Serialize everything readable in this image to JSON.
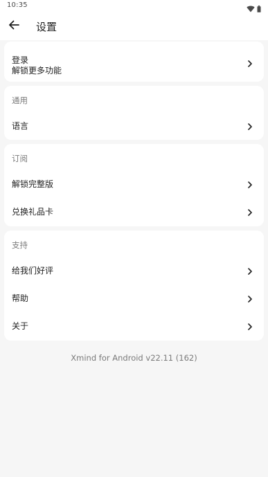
{
  "status_bar": {
    "time": "10:35",
    "icons": [
      "wifi-icon",
      "battery-icon"
    ]
  },
  "app_bar": {
    "back_icon": "arrow-left-icon",
    "title": "设置"
  },
  "account": {
    "title": "登录",
    "subtitle": "解锁更多功能"
  },
  "general": {
    "header": "通用",
    "items": [
      {
        "label": "语言"
      }
    ]
  },
  "subscription": {
    "header": "订阅",
    "items": [
      {
        "label": "解锁完整版"
      },
      {
        "label": "兑换礼品卡"
      }
    ]
  },
  "support": {
    "header": "支持",
    "items": [
      {
        "label": "给我们好评"
      },
      {
        "label": "帮助"
      },
      {
        "label": "关于"
      }
    ]
  },
  "footer": {
    "version": "Xmind for Android v22.11 (162)"
  },
  "colors": {
    "background": "#f6f6f6",
    "card": "#ffffff",
    "text_primary": "#1f1f1f",
    "text_secondary": "#7a7a7a"
  }
}
